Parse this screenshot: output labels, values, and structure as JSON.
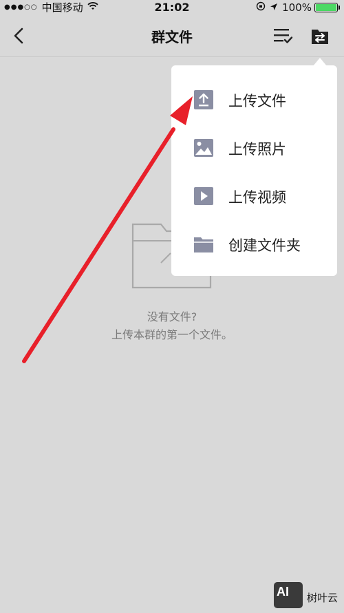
{
  "status_bar": {
    "signal": "●●●○○",
    "carrier": "中国移动",
    "time": "21:02",
    "battery_percent": "100%",
    "battery_level": 1.0,
    "battery_color": "#4cd964"
  },
  "nav": {
    "title": "群文件",
    "back_icon": "chevron-left-icon",
    "sort_icon": "sort-list-icon",
    "upload_icon": "upload-folder-icon"
  },
  "empty_state": {
    "line1": "没有文件?",
    "line2": "上传本群的第一个文件。"
  },
  "menu": {
    "items": [
      {
        "label": "上传文件",
        "icon": "upload-file-icon"
      },
      {
        "label": "上传照片",
        "icon": "image-icon"
      },
      {
        "label": "上传视频",
        "icon": "video-play-icon"
      },
      {
        "label": "创建文件夹",
        "icon": "folder-icon"
      }
    ],
    "icon_color": "#8a8ea3"
  },
  "watermark": {
    "logo_text": "AI",
    "name": "树叶云"
  }
}
